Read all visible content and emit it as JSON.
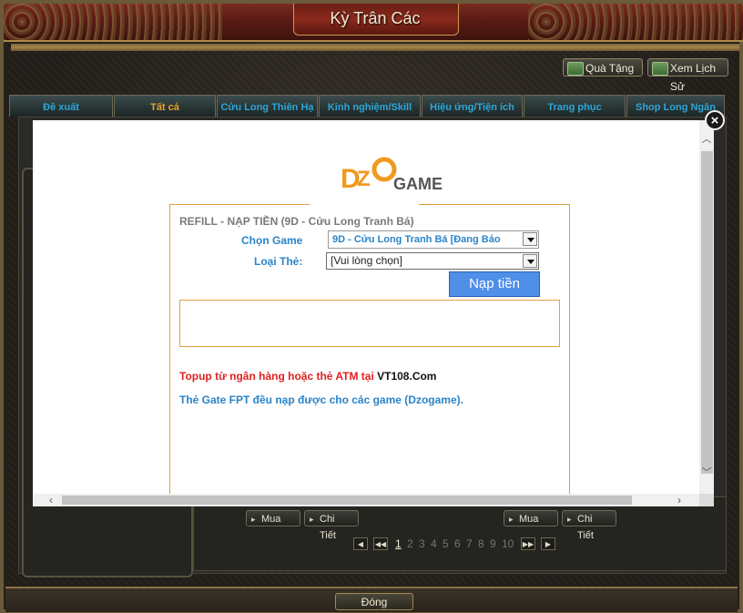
{
  "window": {
    "title": "Kỳ Trân Các"
  },
  "header_buttons": {
    "gift_label": "Quà Tặng",
    "history_label": "Xem Lịch Sử"
  },
  "tabs": [
    {
      "label": "Đề xuất"
    },
    {
      "label": "Tất cả",
      "active": true
    },
    {
      "label": "Cửu Long Thiên Hạ"
    },
    {
      "label": "Kinh nghiệm/Skill"
    },
    {
      "label": "Hiệu ứng/Tiện ích"
    },
    {
      "label": "Trang phục"
    },
    {
      "label": "Shop Long Ngân"
    }
  ],
  "items": {
    "buy_label": "Mua",
    "detail_label": "Chi Tiết"
  },
  "pager": {
    "pages": [
      "1",
      "2",
      "3",
      "4",
      "5",
      "6",
      "7",
      "8",
      "9",
      "10"
    ],
    "current": "1"
  },
  "footer": {
    "close_label": "Đóng"
  },
  "modal": {
    "logo_text": "DZO GAME",
    "refill_title": "REFILL - NẠP TIỀN (9D - Cửu Long Tranh Bá)",
    "choose_game_label": "Chọn Game",
    "choose_game_value": "9D - Cửu Long Tranh Bá [Đang Bảo",
    "card_type_label": "Loại Thẻ:",
    "card_type_value": "[Vui lòng chọn]",
    "submit_label": "Nạp tiền",
    "note_topup": "Topup từ ngân hàng hoặc thẻ ATM tại ",
    "note_topup_site": "VT108.Com",
    "note_gate": "Thẻ Gate FPT đều nạp được cho các game (Dzogame).",
    "close_symbol": "×"
  },
  "colors": {
    "tab_text": "#2ea6d8",
    "tab_active_text": "#e8a22a",
    "accent_blue": "#2a84c8",
    "warning_red": "#e02020",
    "form_border": "#e0a040",
    "submit_bg": "#4f8fe8"
  }
}
